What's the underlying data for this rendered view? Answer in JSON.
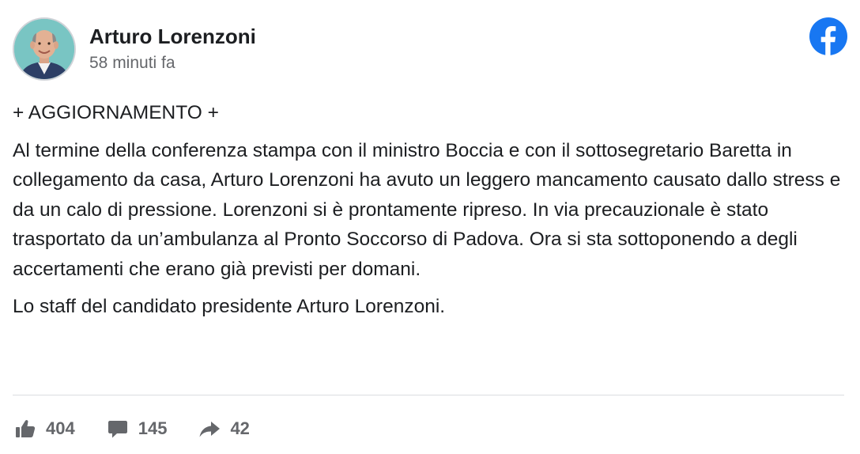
{
  "post": {
    "author": "Arturo Lorenzoni",
    "timestamp": "58 minuti fa",
    "platform_icon": "facebook-icon",
    "paragraphs": [
      "+ AGGIORNAMENTO +",
      "Al termine della conferenza stampa con il ministro Boccia e con il sottosegretario Baretta in collegamento da casa, Arturo Lorenzoni ha avuto un leggero mancamento causato dallo stress e da un calo di pressione. Lorenzoni si è prontamente ripreso. In via precauzionale è stato trasportato da un’ambulanza al Pronto Soccorso di Padova. Ora si sta sottoponendo a degli accertamenti che erano già previsti per domani.",
      "Lo staff del candidato presidente Arturo Lorenzoni."
    ]
  },
  "actions": {
    "likes": {
      "icon": "thumbs-up-icon",
      "count": "404"
    },
    "comments": {
      "icon": "comment-icon",
      "count": "145"
    },
    "shares": {
      "icon": "share-icon",
      "count": "42"
    }
  },
  "colors": {
    "facebook_blue": "#1877f2",
    "text": "#1c1e21",
    "secondary_text": "#65676b",
    "divider": "#dadde1"
  }
}
